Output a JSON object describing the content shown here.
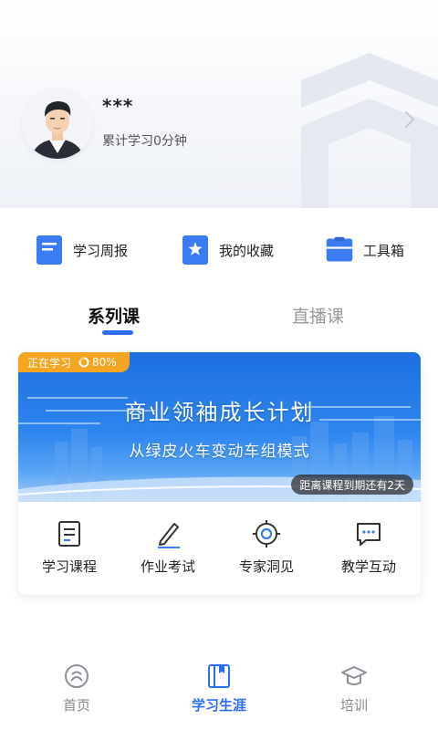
{
  "profile": {
    "username": "***",
    "study_time": "累计学习0分钟"
  },
  "quick_links": [
    {
      "label": "学习周报",
      "icon": "report-icon"
    },
    {
      "label": "我的收藏",
      "icon": "favorites-icon"
    },
    {
      "label": "工具箱",
      "icon": "toolbox-icon"
    }
  ],
  "tabs": [
    {
      "label": "系列课",
      "active": true
    },
    {
      "label": "直播课",
      "active": false
    }
  ],
  "course": {
    "status_badge": "正在学习",
    "progress_label": "80%",
    "progress_fraction": 0.8,
    "title": "商业领袖成长计划",
    "subtitle": "从绿皮火车变动车组模式",
    "expire_notice": "距离课程到期还有2天",
    "actions": [
      {
        "label": "学习课程",
        "icon": "document-icon"
      },
      {
        "label": "作业考试",
        "icon": "pencil-icon"
      },
      {
        "label": "专家洞见",
        "icon": "target-icon"
      },
      {
        "label": "教学互动",
        "icon": "chat-icon"
      }
    ]
  },
  "bottom_nav": [
    {
      "label": "首页",
      "icon": "home-icon",
      "active": false
    },
    {
      "label": "学习生涯",
      "icon": "book-icon",
      "active": true
    },
    {
      "label": "培训",
      "icon": "graduation-cap-icon",
      "active": false
    }
  ],
  "colors": {
    "accent": "#2f6df0",
    "badge": "#f4a623",
    "banner": "#1d6fe0"
  }
}
